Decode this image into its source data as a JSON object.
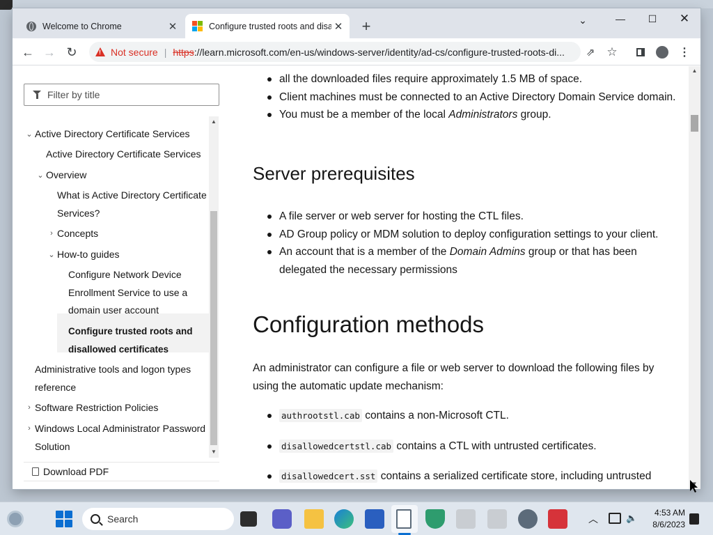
{
  "browser": {
    "tabs": [
      {
        "title": "Welcome to Chrome"
      },
      {
        "title": "Configure trusted roots and disallowed certificates"
      }
    ],
    "security_label": "Not secure",
    "url_scheme": "https",
    "url_rest": "://learn.microsoft.com/en-us/windows-server/identity/ad-cs/configure-trusted-roots-di..."
  },
  "sidebar": {
    "filter_placeholder": "Filter by title",
    "toc": [
      "Active Directory Certificate Services",
      "Active Directory Certificate Services",
      "Overview",
      "What is Active Directory Certificate",
      "Services?",
      "Concepts",
      "How-to guides",
      "Configure Network Device",
      "Enrollment Service to use a",
      "domain user account",
      "Configure trusted roots and",
      "disallowed certificates",
      "Administrative tools and logon types",
      "reference",
      "Software Restriction Policies",
      "Windows Local Administrator Password",
      "Solution"
    ],
    "download_pdf": "Download PDF"
  },
  "article": {
    "client_list": [
      "all the downloaded files require approximately 1.5 MB of space.",
      "Client machines must be connected to an Active Directory Domain Service domain.",
      {
        "pre": "You must be a member of the local ",
        "em": "Administrators",
        "post": " group."
      }
    ],
    "server_heading": "Server prerequisites",
    "server_list": [
      "A file server or web server for hosting the CTL files.",
      "AD Group policy or MDM solution to deploy configuration settings to your client.",
      {
        "pre": "An account that is a member of the ",
        "em": "Domain Admins",
        "post": " group or that has been delegated the necessary permissions"
      }
    ],
    "config_heading": "Configuration methods",
    "config_para": "An administrator can configure a file or web server to download the following files by using the automatic update mechanism:",
    "files": [
      {
        "code": "authrootstl.cab",
        "text": " contains a non-Microsoft CTL."
      },
      {
        "code": "disallowedcertstl.cab",
        "text": " contains a CTL with untrusted certificates."
      },
      {
        "code": "disallowedcert.sst",
        "text": " contains a serialized certificate store, including untrusted certificates."
      }
    ]
  },
  "taskbar": {
    "search_label": "Search",
    "time": "4:53 AM",
    "date": "8/6/2023"
  }
}
